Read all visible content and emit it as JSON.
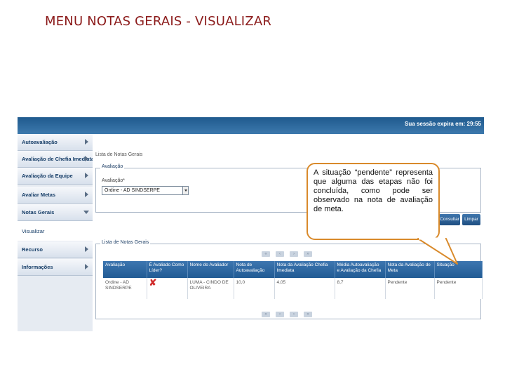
{
  "slide": {
    "title": "MENU NOTAS GERAIS - VISUALIZAR"
  },
  "header": {
    "session_text": "Sua sessão expira em: 29:55"
  },
  "sidebar": {
    "items": [
      {
        "label": "Autoavaliação"
      },
      {
        "label": "Avaliação de Chefia Imediata"
      },
      {
        "label": "Avaliação da Equipe"
      },
      {
        "label": "Avaliar Metas"
      },
      {
        "label": "Notas Gerais"
      }
    ],
    "submenu": {
      "label": "Visualizar"
    },
    "items_after": [
      {
        "label": "Recurso"
      },
      {
        "label": "Informações"
      }
    ]
  },
  "main": {
    "breadcrumb": "Lista de Notas Gerais",
    "filter": {
      "legend": "Avaliação",
      "field_label": "Avaliação*",
      "select_value": "Ordine - AD SINDSERPE"
    },
    "buttons": {
      "consultar": "Consultar",
      "limpar": "Limpar"
    },
    "list": {
      "legend": "Lista de Notas Gerais",
      "columns": [
        "Avaliação",
        "É Avaliado Como Líder?",
        "Nome do Avaliador",
        "Nota de Autoavaliação",
        "Nota da Avaliação Chefia Imediata",
        "Média Autoavaliação e Avaliação da Chefia",
        "Nota da Avaliação de Meta",
        "Situação"
      ],
      "rows": [
        {
          "avaliacao": "Ordine - AD SINDSERPE",
          "lider_icon": "x-icon",
          "avaliador": "LUMA - CINDO DE OLIVEIRA",
          "nota_auto": "10,0",
          "nota_chefia": "4,05",
          "media": "8,7",
          "nota_meta": "Pendente",
          "situacao": "Pendente"
        }
      ]
    },
    "pager": [
      "«",
      "‹",
      "›",
      "»"
    ]
  },
  "callout": {
    "text": "A situação “pendente” representa que alguma das etapas não foi concluída, como pode ser observado na nota de avaliação de meta.",
    "border_color": "#d98a2b"
  }
}
